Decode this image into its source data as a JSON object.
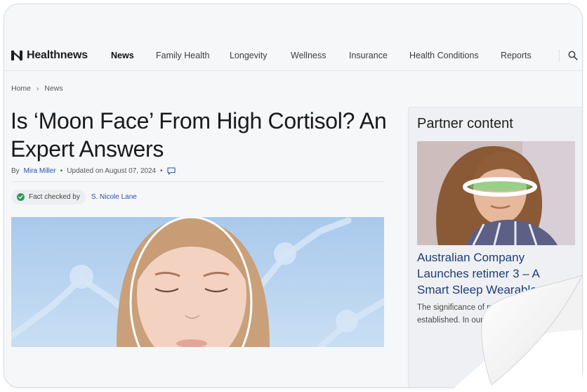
{
  "brand": {
    "name": "Healthnews"
  },
  "nav": {
    "items": [
      "News",
      "Family Health",
      "Longevity",
      "Wellness",
      "Insurance",
      "Health Conditions",
      "Reports"
    ],
    "active": "News",
    "search_icon": "search-icon"
  },
  "breadcrumb": {
    "home": "Home",
    "current": "News",
    "separator": "›"
  },
  "article": {
    "title": "Is ‘Moon Face’ From High Cortisol? An Expert Answers",
    "by_prefix": "By",
    "author": "Mira Miller",
    "updated": "Updated on August 07, 2024",
    "comment_icon": "comment-icon",
    "fact_label": "Fact checked by",
    "fact_checker": "S. Nicole Lane"
  },
  "sidebar": {
    "heading": "Partner content",
    "card_title": "Australian Company Launches retimer 3 – A Smart Sleep Wearable",
    "excerpt": "The significance of mental, and emoti established. In our"
  },
  "colors": {
    "link": "#2b4fa8",
    "card_title": "#1e3d7a",
    "check": "#2e9b5a",
    "page_bg": "#f6f7f9"
  }
}
